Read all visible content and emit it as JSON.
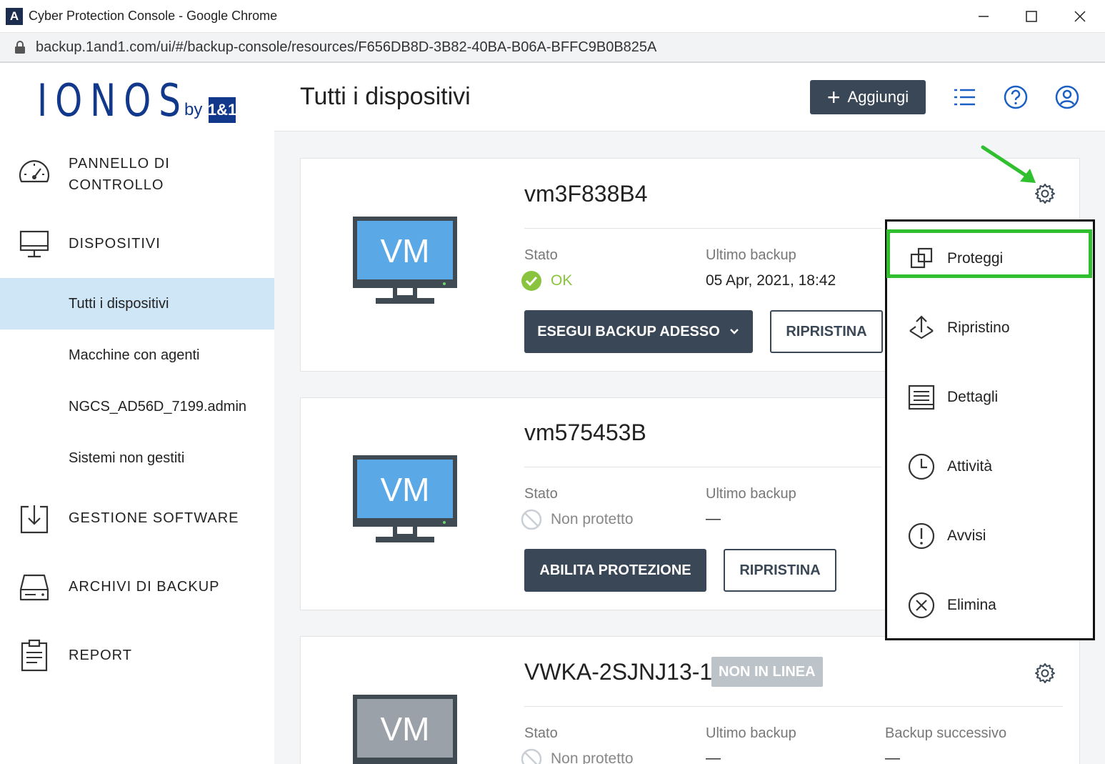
{
  "window": {
    "app_icon": "A",
    "title": "Cyber Protection Console - Google Chrome",
    "url": "backup.1and1.com/ui/#/backup-console/resources/F656DB8D-3B82-40BA-B06A-BFFC9B0B825A"
  },
  "brand": {
    "logo_main": "IONOS",
    "logo_by": "by",
    "logo_box": "1&1"
  },
  "sidebar": {
    "items": [
      {
        "label": "PANNELLO DI CONTROLLO",
        "icon": "dashboard-gauge-icon"
      },
      {
        "label": "DISPOSITIVI",
        "icon": "monitor-icon"
      },
      {
        "label": "GESTIONE SOFTWARE",
        "icon": "software-download-icon"
      },
      {
        "label": "ARCHIVI DI BACKUP",
        "icon": "drive-icon"
      },
      {
        "label": "REPORT",
        "icon": "clipboard-icon"
      }
    ],
    "subitems": [
      {
        "label": "Tutti i dispositivi",
        "active": true
      },
      {
        "label": "Macchine con agenti",
        "active": false
      },
      {
        "label": "NGCS_AD56D_7199.admin",
        "active": false
      },
      {
        "label": "Sistemi non gestiti",
        "active": false
      }
    ]
  },
  "header": {
    "title": "Tutti i dispositivi",
    "add_label": "Aggiungi"
  },
  "devices": [
    {
      "name": "vm3F838B4",
      "vm_label": "VM",
      "state_label": "Stato",
      "state_value": "OK",
      "last_backup_label": "Ultimo backup",
      "last_backup_value": "05 Apr, 2021, 18:42",
      "primary_action": "ESEGUI BACKUP ADESSO",
      "secondary_action": "RIPRISTINA"
    },
    {
      "name": "vm575453B",
      "vm_label": "VM",
      "state_label": "Stato",
      "state_value": "Non protetto",
      "last_backup_label": "Ultimo backup",
      "last_backup_value": "—",
      "primary_action": "ABILITA PROTEZIONE",
      "secondary_action": "RIPRISTINA"
    },
    {
      "name": "VWKA-2SJNJ13-1",
      "badge": "NON IN LINEA",
      "vm_label": "VM",
      "state_label": "Stato",
      "state_value": "Non protetto",
      "last_backup_label": "Ultimo backup",
      "last_backup_value": "—",
      "next_backup_label": "Backup successivo",
      "next_backup_value": "—"
    }
  ],
  "menu": {
    "items": [
      {
        "label": "Proteggi",
        "icon": "protect-icon"
      },
      {
        "label": "Ripristino",
        "icon": "restore-icon"
      },
      {
        "label": "Dettagli",
        "icon": "details-icon"
      },
      {
        "label": "Attività",
        "icon": "activity-clock-icon"
      },
      {
        "label": "Avvisi",
        "icon": "alert-icon"
      },
      {
        "label": "Elimina",
        "icon": "delete-icon"
      }
    ]
  },
  "colors": {
    "brand": "#11388a",
    "button_dark": "#3a4756",
    "active_nav": "#cfe6f6",
    "ok_green": "#8ac43f",
    "annotation_green": "#2fbf2f",
    "vm_screen": "#5aa8e6",
    "vm_offline_screen": "#9aa1a8"
  }
}
